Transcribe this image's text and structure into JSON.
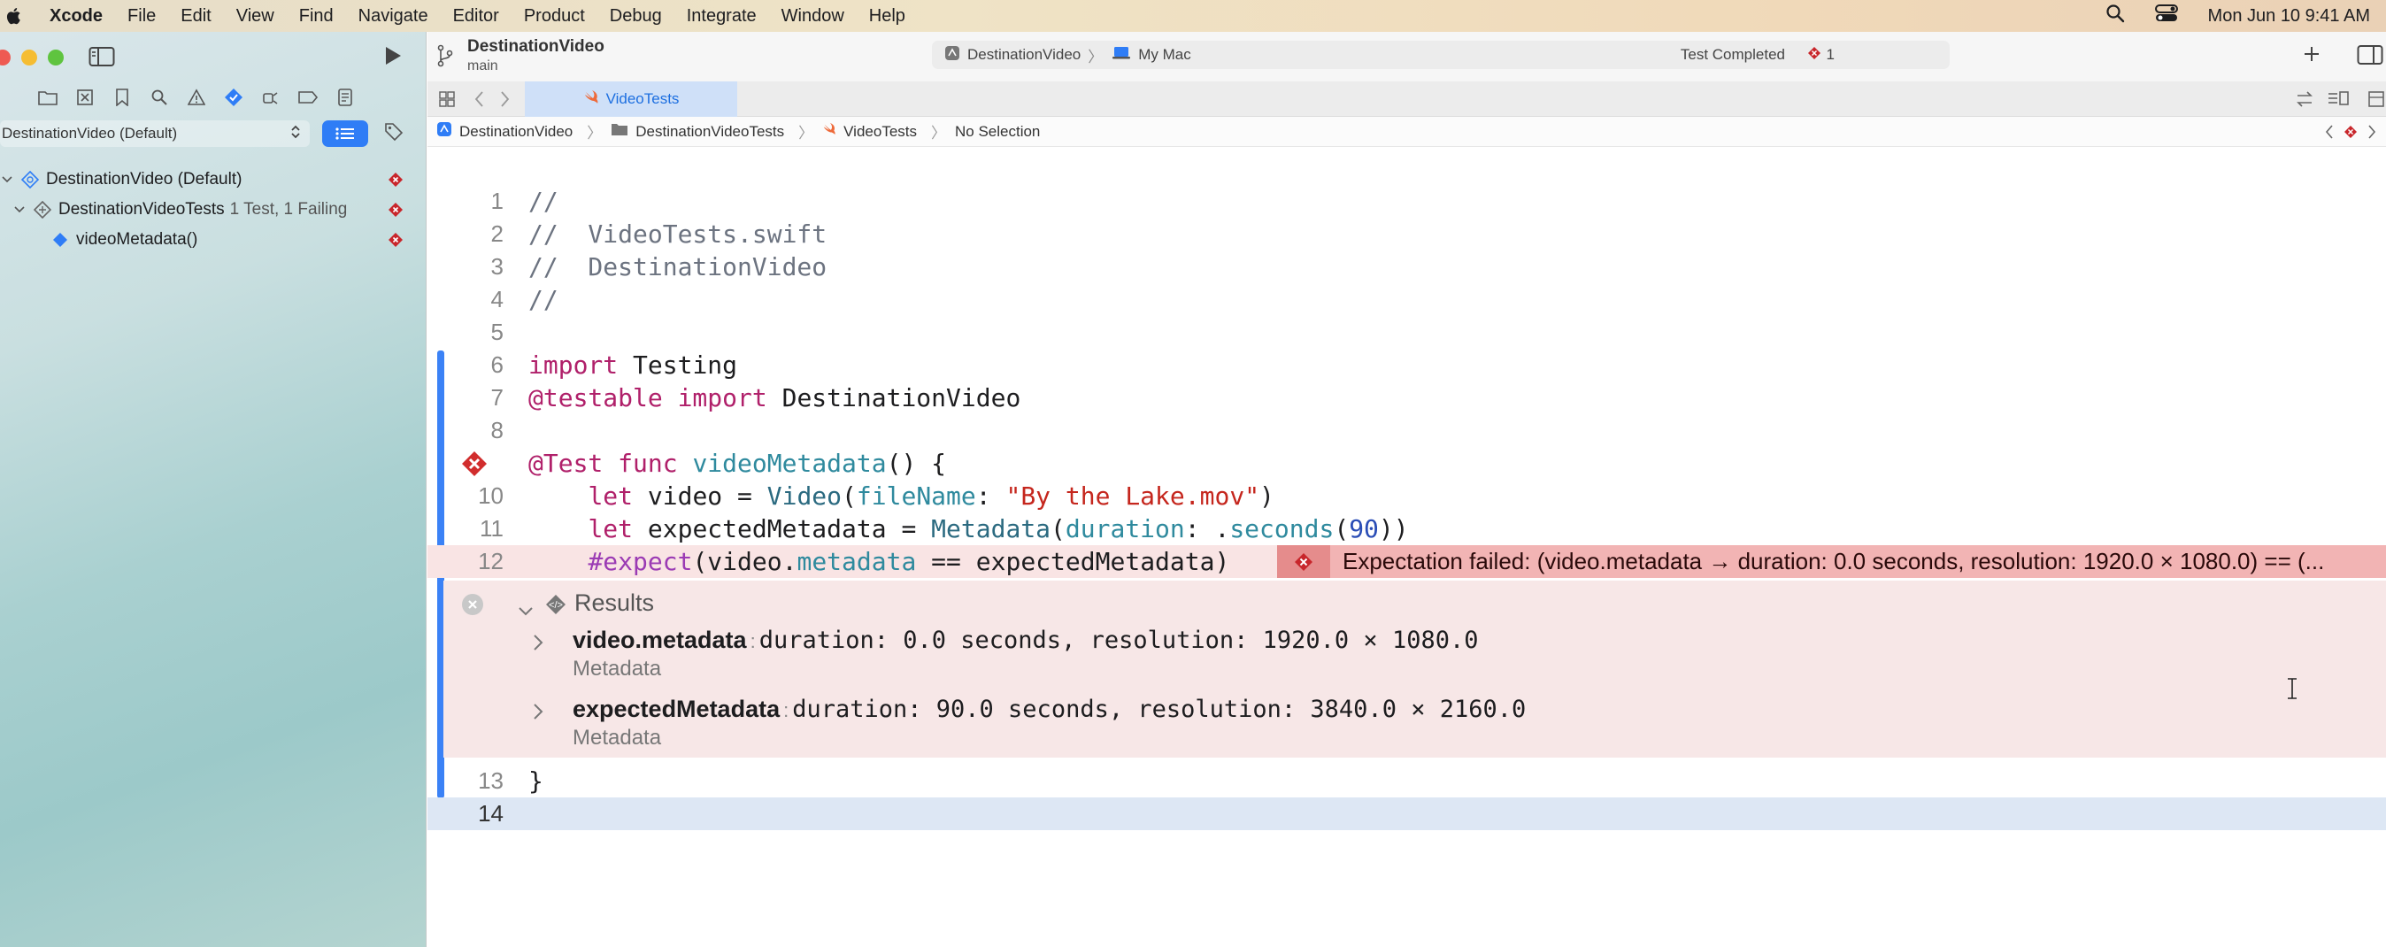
{
  "menubar": {
    "app": "Xcode",
    "items": [
      "File",
      "Edit",
      "View",
      "Find",
      "Navigate",
      "Editor",
      "Product",
      "Debug",
      "Integrate",
      "Window",
      "Help"
    ],
    "clock": "Mon Jun 10  9:41 AM"
  },
  "sidebar": {
    "scheme_filter": "DestinationVideo (Default)",
    "tree": [
      {
        "label": "DestinationVideo (Default)",
        "sub": ""
      },
      {
        "label": "DestinationVideoTests",
        "sub": "1 Test, 1 Failing"
      },
      {
        "label": "videoMetadata()",
        "sub": ""
      }
    ]
  },
  "toolbar": {
    "project": "DestinationVideo",
    "branch": "main",
    "activity_scheme": "DestinationVideo",
    "activity_destination": "My Mac",
    "status": "Test Completed",
    "error_count": "1"
  },
  "tab": {
    "label": "VideoTests"
  },
  "jumpbar": {
    "crumbs": [
      "DestinationVideo",
      "DestinationVideoTests",
      "VideoTests",
      "No Selection"
    ]
  },
  "code": {
    "line_numbers": [
      "1",
      "2",
      "3",
      "4",
      "5",
      "6",
      "7",
      "8",
      "",
      "10",
      "11",
      "12",
      "13",
      "14"
    ],
    "error_message": "Expectation failed: (video.metadata → duration: 0.0 seconds, resolution: 1920.0 × 1080.0) == (...",
    "results": {
      "title": "Results",
      "items": [
        {
          "name": "video.metadata",
          "value": "duration: 0.0 seconds, resolution: 1920.0 × 1080.0",
          "type": "Metadata"
        },
        {
          "name": "expectedMetadata",
          "value": "duration: 90.0 seconds, resolution: 3840.0 × 2160.0",
          "type": "Metadata"
        }
      ]
    }
  },
  "colors": {
    "accent": "#2f7df6",
    "error": "#c8262b",
    "error_banner": "#f2b4b4",
    "results_bg": "#f7e7e7"
  }
}
